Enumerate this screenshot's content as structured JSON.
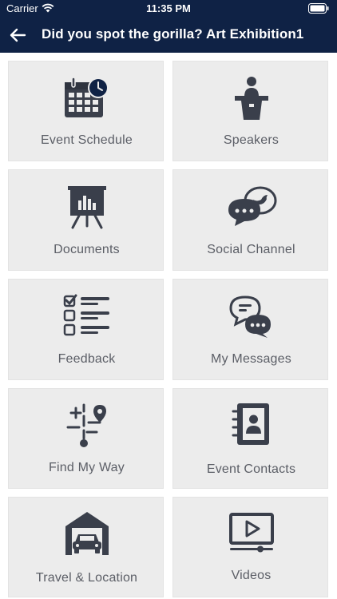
{
  "status_bar": {
    "carrier": "Carrier",
    "time": "11:35 PM"
  },
  "nav": {
    "title": "Did you spot the gorilla? Art Exhibition1"
  },
  "colors": {
    "header_bg": "#0f2245",
    "icon_dark": "#3a3f4b",
    "tile_bg": "#ececec",
    "label_text": "#5b5e66"
  },
  "tiles": [
    {
      "label": "Event Schedule",
      "icon": "calendar-clock-icon"
    },
    {
      "label": "Speakers",
      "icon": "speaker-podium-icon"
    },
    {
      "label": "Documents",
      "icon": "presentation-board-icon"
    },
    {
      "label": "Social Channel",
      "icon": "social-chat-bird-icon"
    },
    {
      "label": "Feedback",
      "icon": "checklist-icon"
    },
    {
      "label": "My Messages",
      "icon": "chat-bubbles-icon"
    },
    {
      "label": "Find My Way",
      "icon": "map-route-pin-icon"
    },
    {
      "label": "Event Contacts",
      "icon": "contact-book-icon"
    },
    {
      "label": "Travel & Location",
      "icon": "car-garage-icon"
    },
    {
      "label": "Videos",
      "icon": "video-player-icon"
    }
  ]
}
